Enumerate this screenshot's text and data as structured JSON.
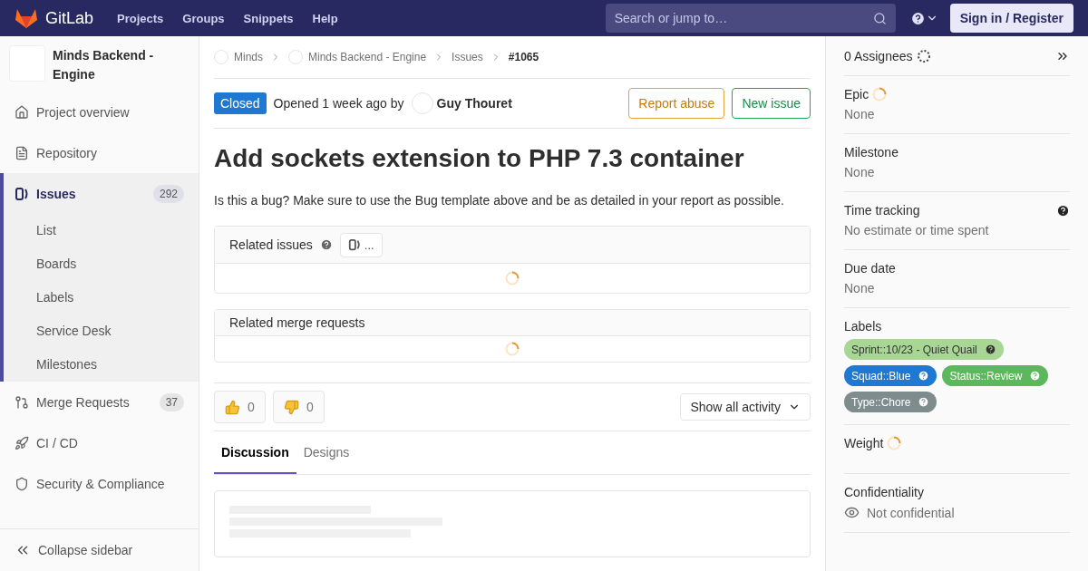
{
  "header": {
    "brand": "GitLab",
    "nav": [
      "Projects",
      "Groups",
      "Snippets",
      "Help"
    ],
    "search": {
      "placeholder": "Search or jump to…"
    },
    "sign_in": "Sign in / Register"
  },
  "sidebar": {
    "project": "Minds Backend - Engine",
    "items": [
      {
        "kind": "home",
        "label": "Project overview",
        "selected": false
      },
      {
        "kind": "repo",
        "label": "Repository",
        "selected": false
      },
      {
        "kind": "issues",
        "label": "Issues",
        "count": "292",
        "selected": true,
        "children": [
          {
            "label": "List"
          },
          {
            "label": "Boards"
          },
          {
            "label": "Labels"
          },
          {
            "label": "Service Desk"
          },
          {
            "label": "Milestones"
          }
        ]
      },
      {
        "kind": "merge",
        "label": "Merge Requests",
        "count": "37",
        "selected": false
      },
      {
        "kind": "cicd",
        "label": "CI / CD",
        "selected": false
      },
      {
        "kind": "security",
        "label": "Security & Compliance",
        "selected": false
      }
    ],
    "collapse": "Collapse sidebar"
  },
  "breadcrumbs": [
    {
      "kind": "avatar",
      "label": "Minds"
    },
    {
      "kind": "avatar",
      "label": "Minds Backend - Engine"
    },
    {
      "kind": "plain",
      "label": "Issues"
    },
    {
      "kind": "current",
      "label": "#1065"
    }
  ],
  "issue": {
    "status": "Closed",
    "opened": "Opened 1 week ago by",
    "author": "Guy Thouret",
    "actions": [
      {
        "kind": "warning",
        "label": "Report abuse"
      },
      {
        "kind": "success",
        "label": "New issue"
      }
    ],
    "title": "Add sockets extension to PHP 7.3 container",
    "description": "Is this a bug? Make sure to use the Bug template above and be as detailed in your report as possible."
  },
  "related": [
    {
      "title": "Related issues",
      "help": true,
      "badge": "...",
      "loading": true
    },
    {
      "title": "Related merge requests",
      "help": false,
      "loading": true
    }
  ],
  "awards": [
    {
      "kind": "up",
      "count": "0"
    },
    {
      "kind": "down",
      "count": "0"
    }
  ],
  "activity_filter": "Show all activity",
  "tabs": [
    {
      "label": "Discussion",
      "selected": true
    },
    {
      "label": "Designs",
      "selected": false
    }
  ],
  "right_sidebar": {
    "assignees": "0 Assignees",
    "assignees_loading": true,
    "sections": [
      {
        "kind": "value",
        "title": "Epic",
        "value": "None",
        "loading": true,
        "help": false
      },
      {
        "kind": "value",
        "title": "Milestone",
        "value": "None",
        "loading": false,
        "help": false
      },
      {
        "kind": "value",
        "title": "Time tracking",
        "value": "No estimate or time spent",
        "loading": false,
        "help": true
      },
      {
        "kind": "value",
        "title": "Due date",
        "value": "None",
        "loading": false,
        "help": false
      },
      {
        "kind": "labels",
        "title": "Labels",
        "loading": false,
        "help": false,
        "labels": [
          {
            "label": "Sprint::10/23 - Quiet Quail",
            "color": "#a8d695"
          },
          {
            "label": "Squad::Blue",
            "color": "#1f78d1"
          },
          {
            "label": "Status::Review",
            "color": "#5cb85c"
          },
          {
            "label": "Type::Chore",
            "color": "#7f8c8d"
          }
        ]
      },
      {
        "kind": "value",
        "title": "Weight",
        "loading": true,
        "help": false
      },
      {
        "kind": "confidentiality",
        "title": "Confidentiality",
        "value": "Not confidential",
        "loading": false,
        "help": false
      }
    ]
  }
}
